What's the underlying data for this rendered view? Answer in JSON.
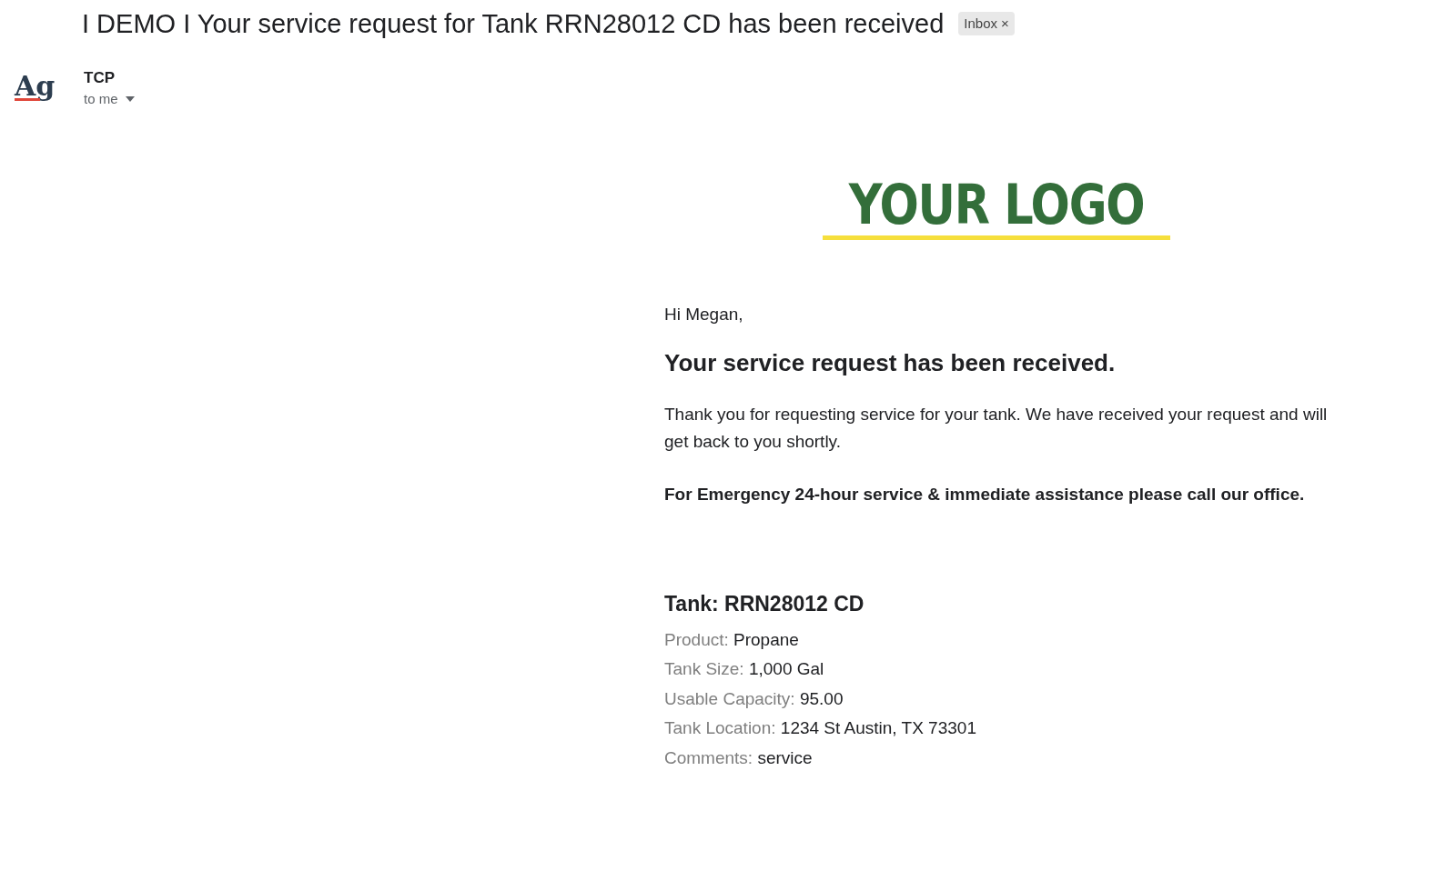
{
  "subject": "I DEMO I Your service request for Tank RRN28012 CD has been received",
  "label": {
    "text": "Inbox",
    "remove": "×"
  },
  "sender": {
    "avatar": "Ag",
    "name": "TCP",
    "recipient": "to me"
  },
  "email": {
    "logo": "YOUR LOGO",
    "greeting": "Hi Megan,",
    "heading": "Your service request has been received.",
    "paragraph": "Thank you for requesting service for your tank. We have received your request and will get back to you shortly.",
    "emergency": "For Emergency 24-hour service & immediate assistance please call our office.",
    "tank_title": "Tank: RRN28012 CD",
    "details": [
      {
        "label": "Product:",
        "value": "Propane"
      },
      {
        "label": "Tank Size:",
        "value": "1,000 Gal"
      },
      {
        "label": "Usable Capacity:",
        "value": "95.00"
      },
      {
        "label": "Tank Location:",
        "value": "1234 St Austin, TX 73301"
      },
      {
        "label": "Comments:",
        "value": "service"
      }
    ]
  }
}
